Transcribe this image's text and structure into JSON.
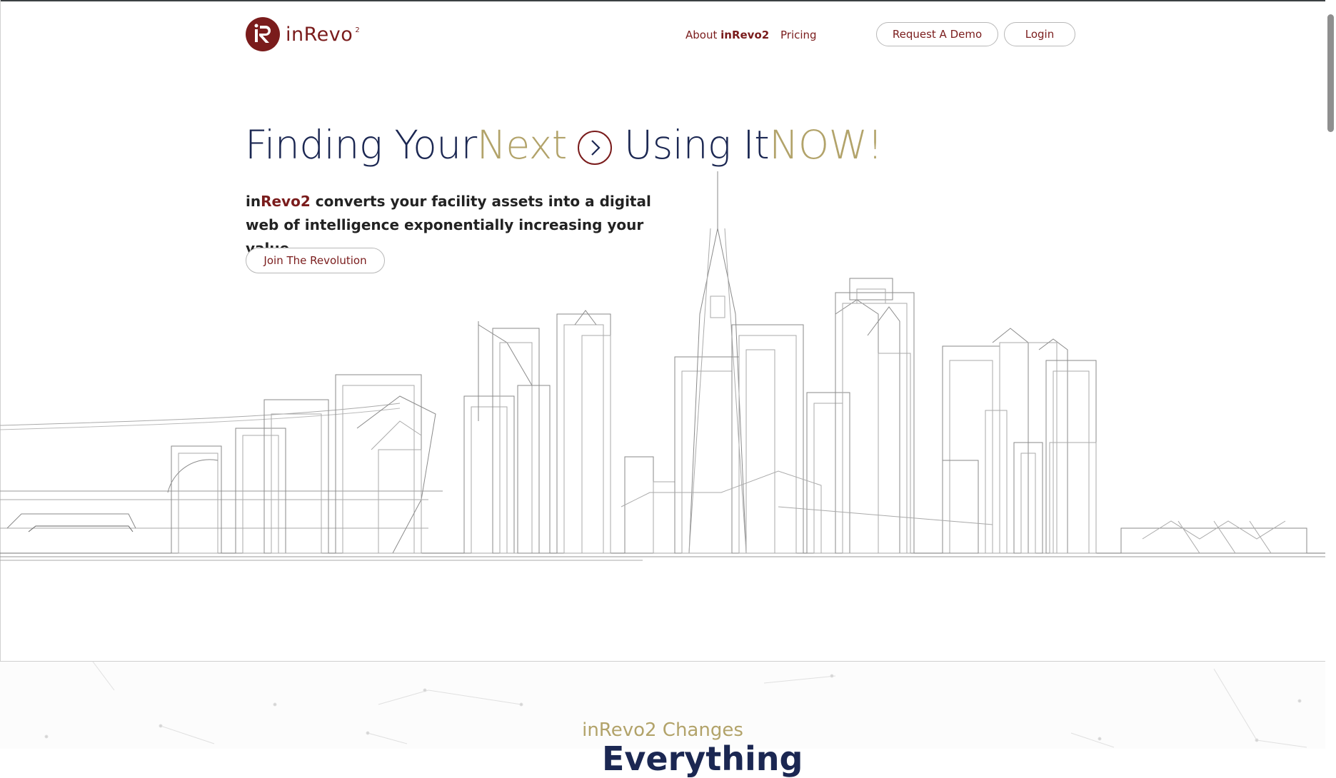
{
  "header": {
    "logo_text": "inRevo",
    "logo_sup": "2",
    "nav": {
      "about_prefix": "About ",
      "about_brand": "inRevo2",
      "pricing": "Pricing"
    },
    "request_demo": "Request A Demo",
    "login": "Login"
  },
  "hero": {
    "title_part1": "Finding Your ",
    "title_next": "Next",
    "title_part2": "Using It ",
    "title_now": "NOW!",
    "sub_in": "in",
    "sub_brand": "Revo2",
    "sub_text": " converts your facility assets into a digital web of intelligence exponentially increasing your value",
    "cta": "Join The Revolution"
  },
  "section2": {
    "label": "inRevo2 Changes",
    "heading": "Everything"
  },
  "colors": {
    "brand_red": "#7a1c1c",
    "navy": "#1b2752",
    "gold": "#b2a36a"
  },
  "icons": {
    "hero_arrow": "chevron-right-circle-icon",
    "logo": "ir-logo-icon"
  }
}
